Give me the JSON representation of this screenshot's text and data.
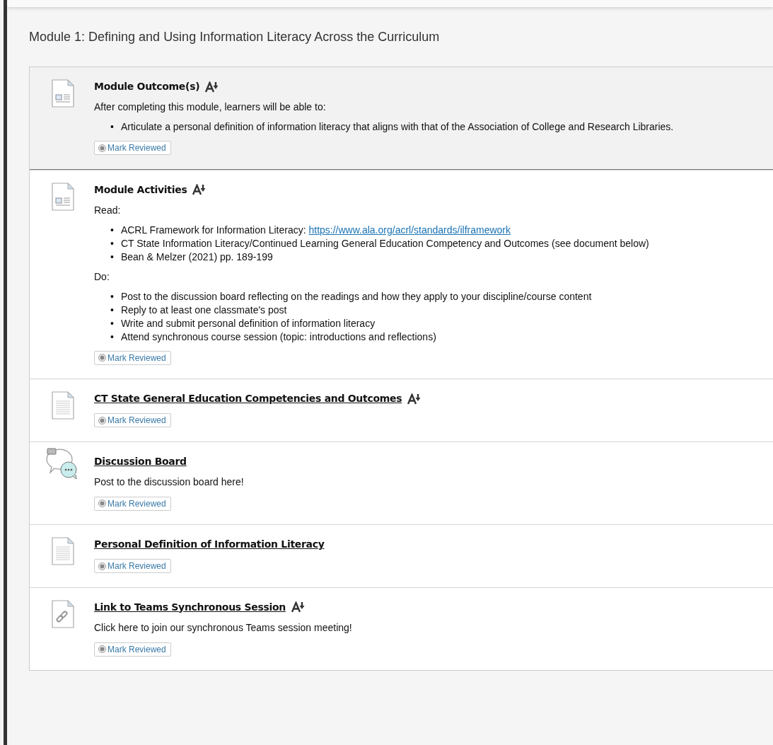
{
  "module_title": "Module 1: Defining and Using Information Literacy Across the Curriculum",
  "items": [
    {
      "kind": "document",
      "title": "Module Outcome(s)",
      "linked": false,
      "alt_formats": true,
      "selected": true,
      "button": "Mark Reviewed",
      "body": [
        {
          "text": "After completing this module, learners will be able to:"
        },
        {
          "bullets": [
            {
              "marker": "•",
              "text": "Articulate a personal definition of information literacy that aligns with that of the Association of College and Research Libraries."
            }
          ]
        }
      ]
    },
    {
      "kind": "document",
      "title": "Module Activities",
      "linked": false,
      "alt_formats": true,
      "selected": false,
      "button": "Mark Reviewed",
      "body": [
        {
          "text": "Read:"
        },
        {
          "bullets": [
            {
              "marker": "•",
              "text": "ACRL Framework for Information Literacy: ",
              "link": "https://www.ala.org/acrl/standards/ilframework"
            },
            {
              "marker": "•",
              "text": "CT State Information Literacy/Continued Learning General Education Competency and Outcomes (see document below)"
            },
            {
              "marker": "•",
              "text": "Bean & Melzer (2021) pp. 189-199"
            }
          ]
        },
        {
          "text": "Do:"
        },
        {
          "bullets": [
            {
              "marker": "•",
              "text": "Post to the discussion board reflecting on the readings and how they apply to your discipline/course content"
            },
            {
              "marker": "•",
              "text": "Reply to at least one classmate's post"
            },
            {
              "marker": "•",
              "text": "Write and submit personal definition of information literacy"
            },
            {
              "marker": "•",
              "text": "Attend synchronous course session (topic: introductions and reflections)"
            }
          ]
        }
      ]
    },
    {
      "kind": "file",
      "title": "CT State General Education Competencies and Outcomes",
      "linked": true,
      "alt_formats": true,
      "selected": false,
      "button": "Mark Reviewed"
    },
    {
      "kind": "discussion",
      "title": "Discussion Board",
      "linked": true,
      "alt_formats": false,
      "selected": false,
      "button": "Mark Reviewed",
      "body": [
        {
          "text": "Post to the discussion board here!"
        }
      ]
    },
    {
      "kind": "file",
      "title": "Personal Definition of Information Literacy",
      "linked": true,
      "alt_formats": false,
      "selected": false,
      "button": "Mark Reviewed"
    },
    {
      "kind": "link",
      "title": "Link to Teams Synchronous Session",
      "linked": true,
      "alt_formats": true,
      "selected": false,
      "button": "Mark Reviewed",
      "body": [
        {
          "text": "Click here to join our synchronous Teams session meeting!"
        }
      ]
    }
  ]
}
